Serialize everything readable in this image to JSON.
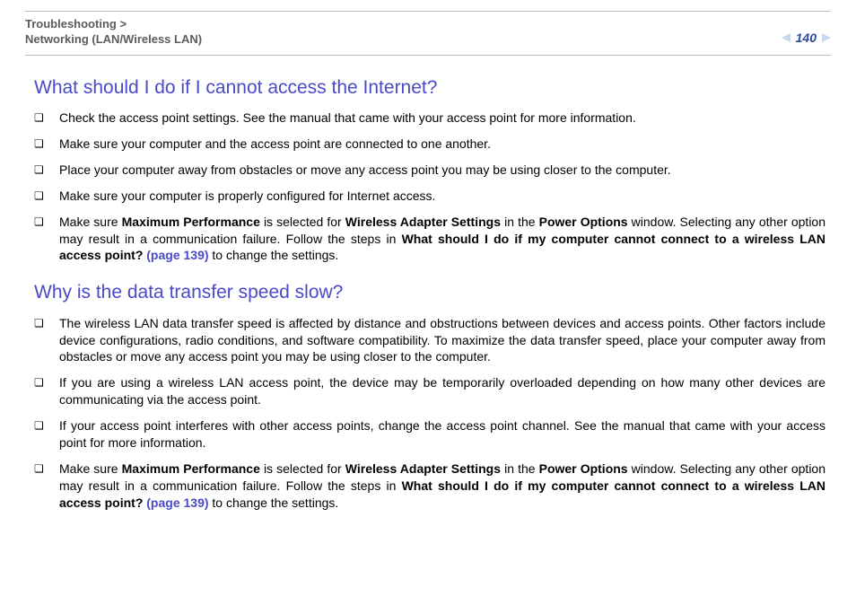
{
  "header": {
    "breadcrumb_line1": "Troubleshooting",
    "breadcrumb_sep": ">",
    "breadcrumb_line2": "Networking (LAN/Wireless LAN)",
    "page_number": "140"
  },
  "sections": [
    {
      "heading": "What should I do if I cannot access the Internet?",
      "items": [
        {
          "html": "Check the access point settings. See the manual that came with your access point for more information."
        },
        {
          "html": "Make sure your computer and the access point are connected to one another."
        },
        {
          "html": "Place your computer away from obstacles or move any access point you may be using closer to the computer."
        },
        {
          "html": "Make sure your computer is properly configured for Internet access."
        },
        {
          "html": "Make sure <b>Maximum Performance</b> is selected for <b>Wireless Adapter Settings</b> in the <b>Power Options</b> window. Selecting any other option may result in a communication failure. Follow the steps in <b>What should I do if my computer cannot connect to a wireless LAN access point? <span class=\"pageref\">(page 139)</span></b> to change the settings."
        }
      ]
    },
    {
      "heading": "Why is the data transfer speed slow?",
      "items": [
        {
          "html": "The wireless LAN data transfer speed is affected by distance and obstructions between devices and access points. Other factors include device configurations, radio conditions, and software compatibility. To maximize the data transfer speed, place your computer away from obstacles or move any access point you may be using closer to the computer."
        },
        {
          "html": "If you are using a wireless LAN access point, the device may be temporarily overloaded depending on how many other devices are communicating via the access point."
        },
        {
          "html": "If your access point interferes with other access points, change the access point channel. See the manual that came with your access point for more information."
        },
        {
          "html": "Make sure <b>Maximum Performance</b> is selected for <b>Wireless Adapter Settings</b> in the <b>Power Options</b> window. Selecting any other option may result in a communication failure. Follow the steps in <b>What should I do if my computer cannot connect to a wireless LAN access point? <span class=\"pageref\">(page 139)</span></b> to change the settings."
        }
      ]
    }
  ],
  "bullet_glyph": "❏"
}
